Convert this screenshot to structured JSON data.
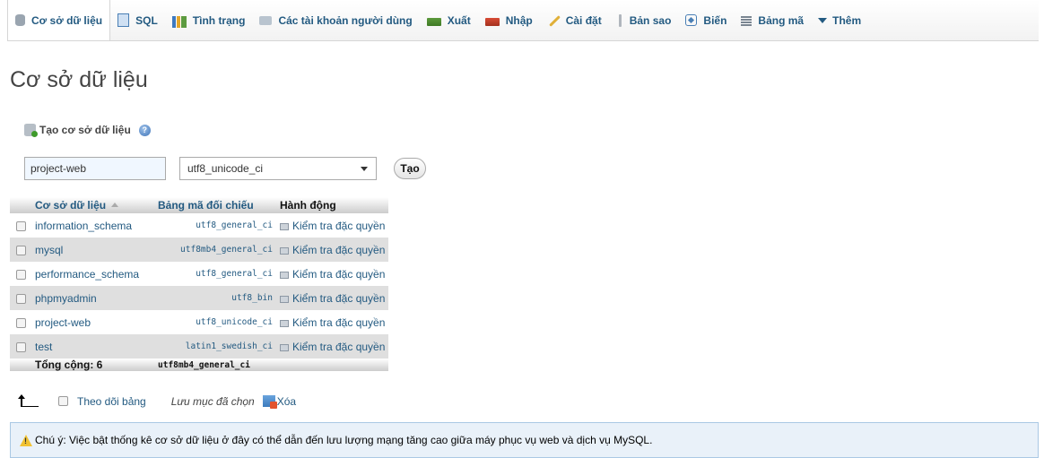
{
  "tabs": [
    {
      "label": "Cơ sở dữ liệu",
      "icon": "database-icon",
      "active": true
    },
    {
      "label": "SQL",
      "icon": "sql-icon"
    },
    {
      "label": "Tình trạng",
      "icon": "status-icon"
    },
    {
      "label": "Các tài khoản người dùng",
      "icon": "users-icon"
    },
    {
      "label": "Xuất",
      "icon": "export-icon"
    },
    {
      "label": "Nhập",
      "icon": "import-icon"
    },
    {
      "label": "Cài đặt",
      "icon": "settings-icon"
    },
    {
      "label": "Bản sao",
      "icon": "replication-icon"
    },
    {
      "label": "Biến",
      "icon": "variables-icon"
    },
    {
      "label": "Bảng mã",
      "icon": "charset-icon"
    },
    {
      "label": "Thêm",
      "icon": "more-icon"
    }
  ],
  "page_title": "Cơ sở dữ liệu",
  "create": {
    "heading": "Tạo cơ sở dữ liệu",
    "db_name_value": "project-web",
    "collation_value": "utf8_unicode_ci",
    "submit_label": "Tạo"
  },
  "table": {
    "headers": {
      "name": "Cơ sở dữ liệu",
      "collation": "Bảng mã đối chiếu",
      "action": "Hành động"
    },
    "rows": [
      {
        "name": "information_schema",
        "collation": "utf8_general_ci",
        "action": "Kiểm tra đặc quyền"
      },
      {
        "name": "mysql",
        "collation": "utf8mb4_general_ci",
        "action": "Kiểm tra đặc quyền"
      },
      {
        "name": "performance_schema",
        "collation": "utf8_general_ci",
        "action": "Kiểm tra đặc quyền"
      },
      {
        "name": "phpmyadmin",
        "collation": "utf8_bin",
        "action": "Kiểm tra đặc quyền"
      },
      {
        "name": "project-web",
        "collation": "utf8_unicode_ci",
        "action": "Kiểm tra đặc quyền"
      },
      {
        "name": "test",
        "collation": "latin1_swedish_ci",
        "action": "Kiểm tra đặc quyền"
      }
    ],
    "total_label": "Tổng cộng: 6",
    "total_collation": "utf8mb4_general_ci"
  },
  "bulk": {
    "check_all_label": "Theo dõi bảng",
    "with_selected_label": "Lưu mục đã chọn",
    "delete_label": "Xóa"
  },
  "notice": {
    "text": "Chú ý: Việc bật thống kê cơ sở dữ liệu ở đây có thể dẫn đến lưu lượng mạng tăng cao giữa máy phục vụ web và dịch vụ MySQL."
  },
  "colors": {
    "link": "#235a81",
    "notice_bg": "#e9f1f9",
    "notice_border": "#aac8e4",
    "row_alt": "#dfdfdf"
  }
}
